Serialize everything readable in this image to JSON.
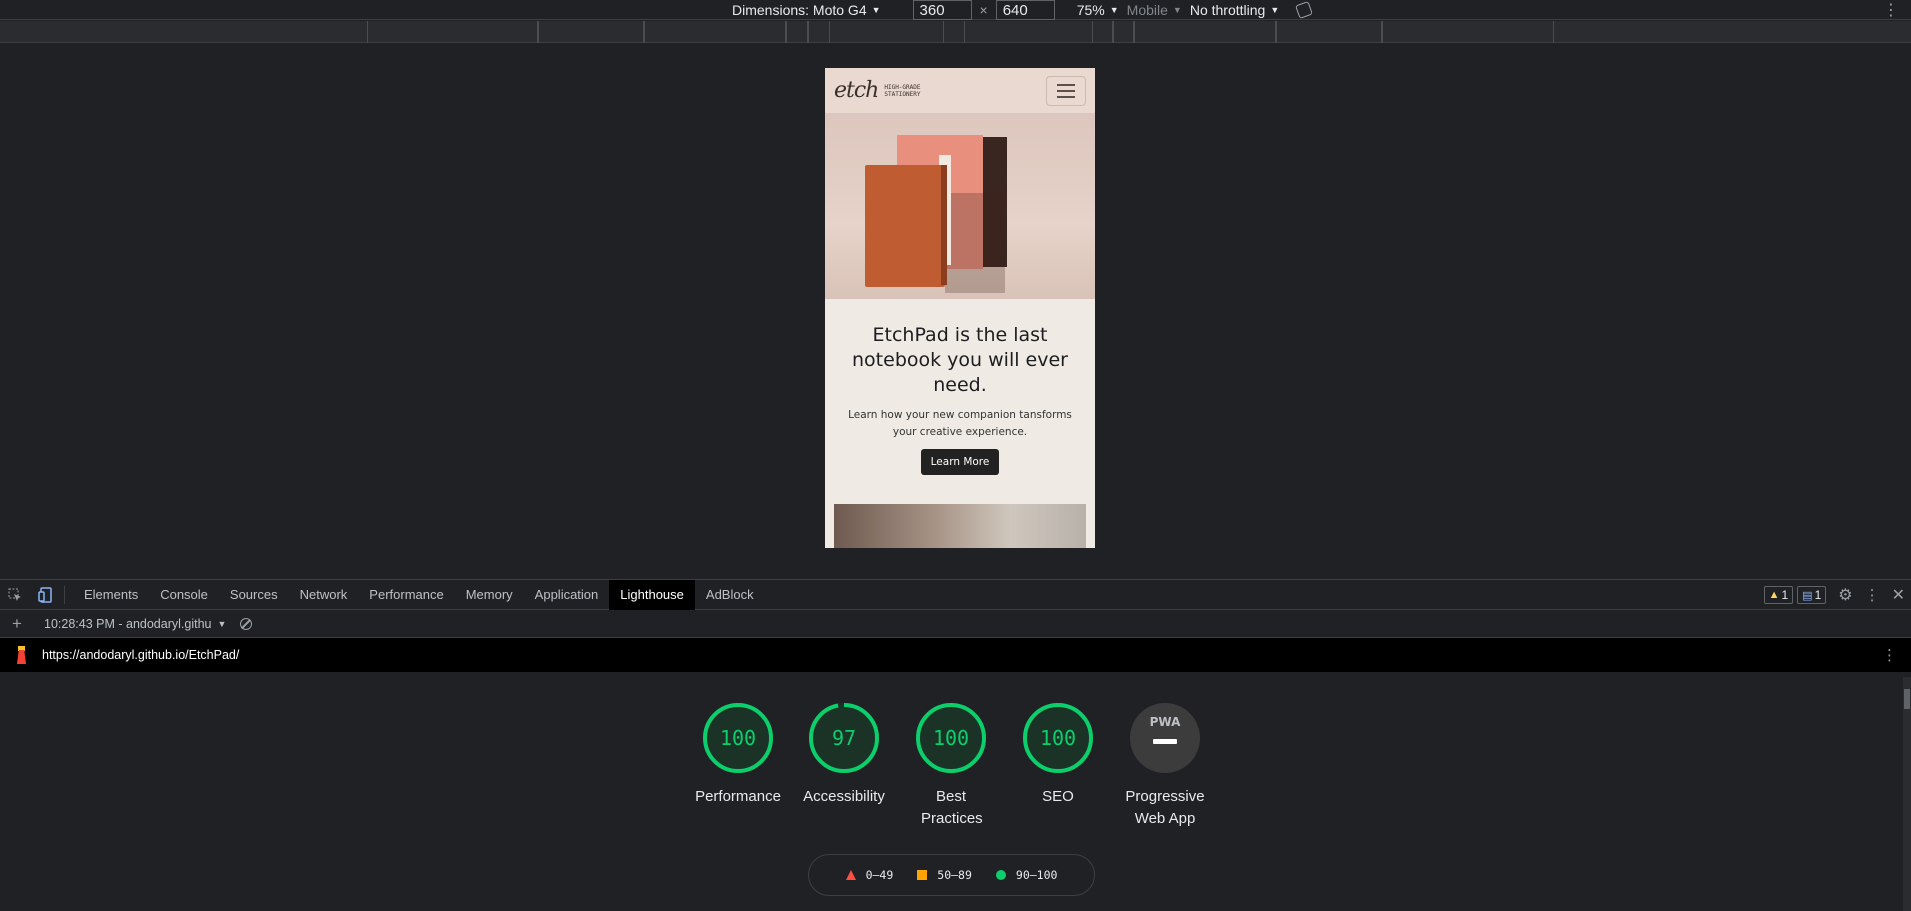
{
  "device_toolbar": {
    "dimensions_label": "Dimensions: Moto G4",
    "width": "360",
    "times": "×",
    "height": "640",
    "zoom": "75%",
    "device_type": "Mobile",
    "throttling": "No throttling"
  },
  "site": {
    "logo_script": "etch",
    "logo_sub_1": "HIGH-GRADE",
    "logo_sub_2": "STATIONERY",
    "hero_title": "EtchPad is the last notebook you will ever need.",
    "hero_subtitle": "Learn how your new companion tansforms your creative experience.",
    "hero_button": "Learn More"
  },
  "devtools": {
    "tabs": [
      "Elements",
      "Console",
      "Sources",
      "Network",
      "Performance",
      "Memory",
      "Application",
      "Lighthouse",
      "AdBlock"
    ],
    "active_tab": "Lighthouse",
    "warnings_count": "1",
    "messages_count": "1",
    "report_label": "10:28:43 PM - andodaryl.githu",
    "url": "https://andodaryl.github.io/EtchPad/",
    "scores": [
      {
        "label": "Performance",
        "value": "100",
        "score": 1.0
      },
      {
        "label": "Accessibility",
        "value": "97",
        "score": 0.97
      },
      {
        "label": "Best Practices",
        "value": "100",
        "score": 1.0
      },
      {
        "label": "SEO",
        "value": "100",
        "score": 1.0
      }
    ],
    "pwa": {
      "badge": "PWA",
      "label": "Progressive Web App"
    },
    "legend": [
      {
        "range": "0–49",
        "color": "#ff4e42"
      },
      {
        "range": "50–89",
        "color": "#ffa400"
      },
      {
        "range": "90–100",
        "color": "#0cce6b"
      }
    ],
    "colors": {
      "pass": "#0cce6b",
      "pass_bg": "#1b3327"
    }
  }
}
